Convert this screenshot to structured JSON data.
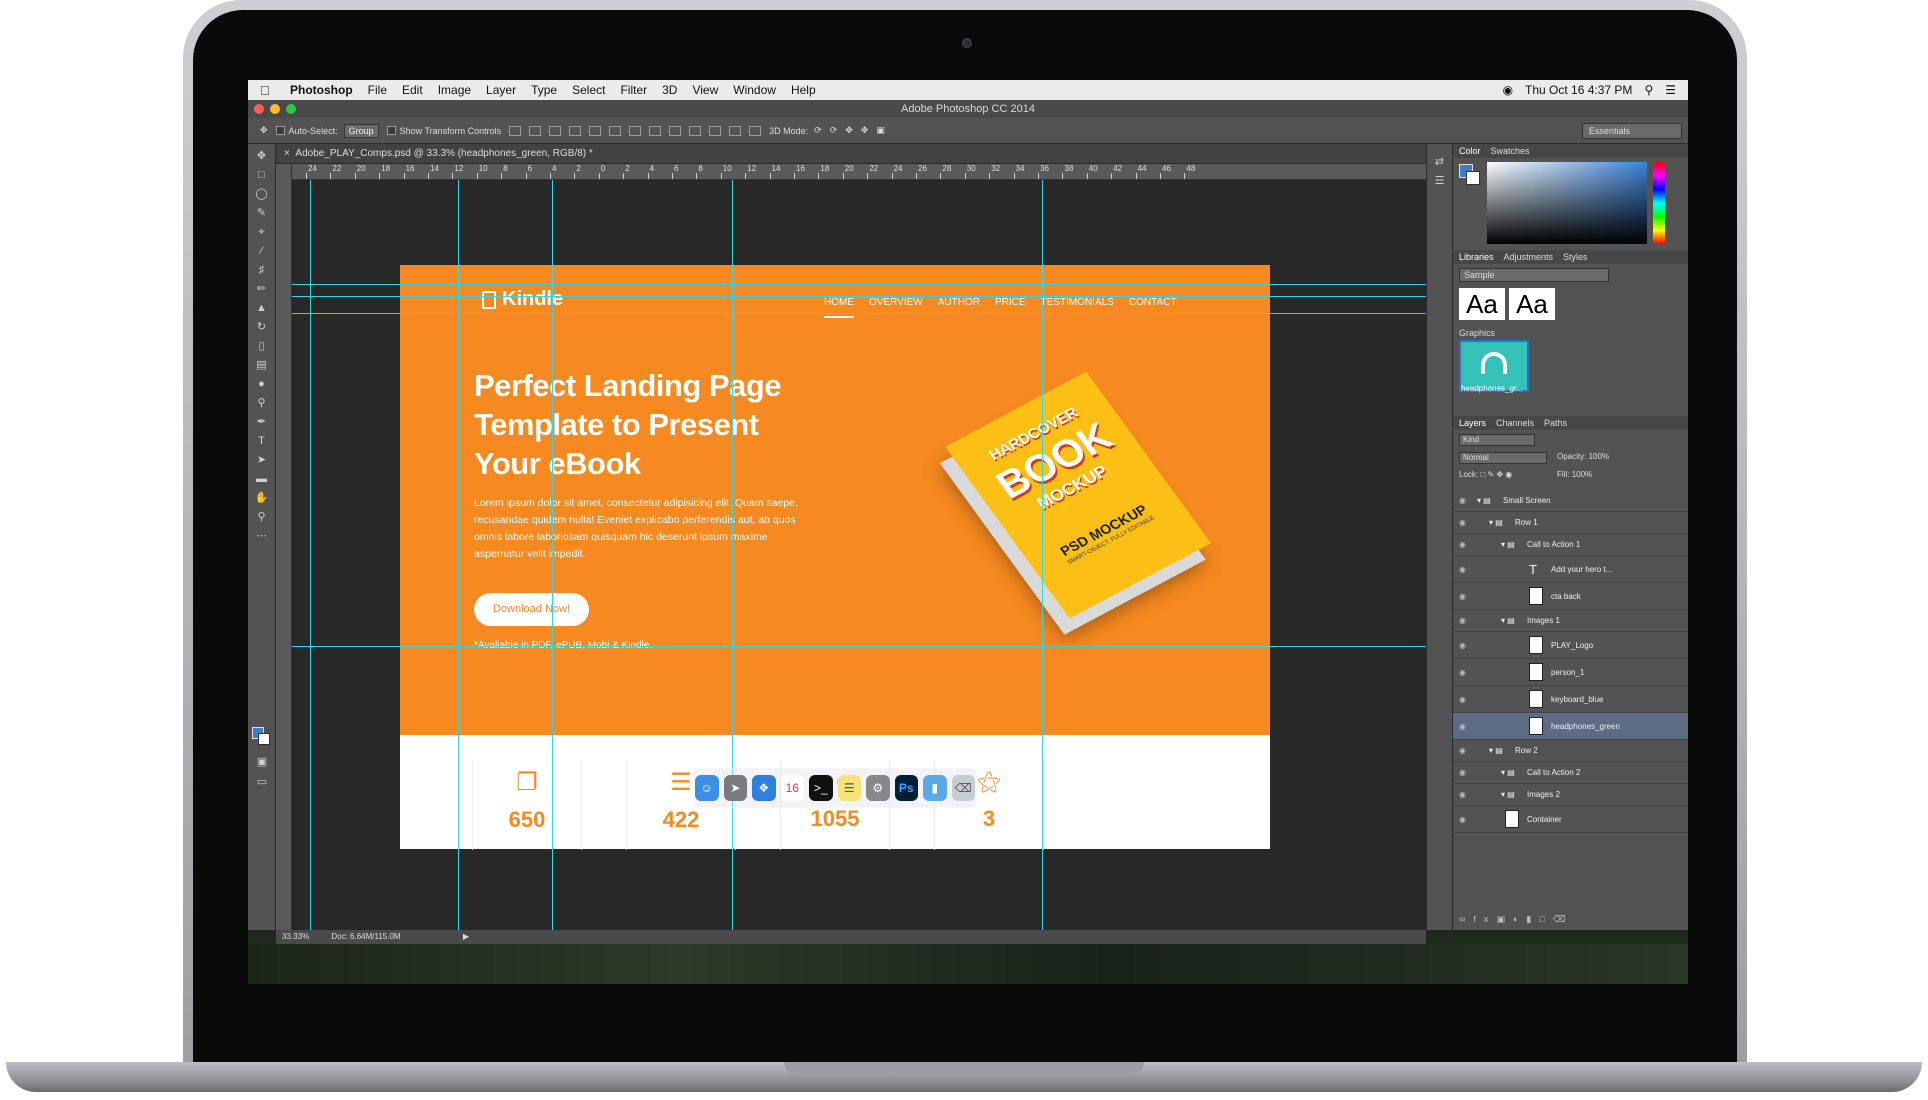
{
  "menubar": {
    "app_name": "Photoshop",
    "items": [
      "File",
      "Edit",
      "Image",
      "Layer",
      "Type",
      "Select",
      "Filter",
      "3D",
      "View",
      "Window",
      "Help"
    ],
    "clock": "Thu Oct 16  4:37 PM"
  },
  "window": {
    "title": "Adobe Photoshop CC 2014"
  },
  "options": {
    "auto_select": "Auto-Select:",
    "group_value": "Group",
    "show_transform": "Show Transform Controls",
    "mode_3d": "3D Mode:",
    "workspace": "Essentials"
  },
  "document": {
    "tab_title": "Adobe_PLAY_Comps.psd @ 33.3% (headphones_green, RGB/8) *",
    "zoom": "33.33%",
    "doc_size": "Doc: 6.64M/115.0M"
  },
  "ruler_h": [
    "24",
    "22",
    "20",
    "18",
    "16",
    "14",
    "12",
    "10",
    "8",
    "6",
    "4",
    "2",
    "0",
    "2",
    "4",
    "6",
    "8",
    "10",
    "12",
    "14",
    "16",
    "18",
    "20",
    "22",
    "24",
    "26",
    "28",
    "30",
    "32",
    "34",
    "36",
    "38",
    "40",
    "42",
    "44",
    "46",
    "48"
  ],
  "landing": {
    "logo": "Kindle",
    "nav": [
      "HOME",
      "OVERVIEW",
      "AUTHOR",
      "PRICE",
      "TESTIMONIALS",
      "CONTACT"
    ],
    "hero_title": "Perfect Landing Page Template to Present Your eBook",
    "hero_text": "Lorem ipsum dolor sit amet, consectetur adipisicing elit. Quam saepe, recusandae quidem nulla! Eveniet explicabo perferendis aut, ab quos omnis labore laboriosam quisquam hic deserunt ipsum maxime aspernatur velit impedit.",
    "cta_label": "Download Now!",
    "availability": "*Avaliable in PDF, ePUB, Mobi & Kindle.",
    "book": {
      "line1": "HARDCOVER",
      "line2": "BOOK",
      "line3": "MOCKUP",
      "line4": "PSD MOCKUP",
      "line5": "SMART-OBJECT, FULLY EDITABLE"
    },
    "stats": [
      "650",
      "422",
      "1055",
      "3"
    ],
    "stat_icons": [
      "copy-icon",
      "document-icon",
      "users-icon",
      "trophy-icon"
    ],
    "brand_color": "#f6891f"
  },
  "panels": {
    "color_tabs": [
      "Color",
      "Swatches"
    ],
    "library_tabs": [
      "Libraries",
      "Adjustments",
      "Styles"
    ],
    "library_name": "Sample",
    "aa_samples": [
      "Aa",
      "Aa"
    ],
    "graphics_label": "Graphics",
    "graphic_name": "headphones_gr...",
    "layers_tabs": [
      "Layers",
      "Channels",
      "Paths"
    ],
    "kind": "Kind",
    "blend": "Normal",
    "opacity_label": "Opacity:",
    "opacity": "100%",
    "lock_label": "Lock:",
    "fill_label": "Fill:",
    "fill": "100%",
    "layers": [
      {
        "name": "Small Screen",
        "indent": 0,
        "type": "group"
      },
      {
        "name": "Row 1",
        "indent": 1,
        "type": "group"
      },
      {
        "name": "Call to Action 1",
        "indent": 2,
        "type": "group"
      },
      {
        "name": "Add your hero t...",
        "indent": 3,
        "type": "text"
      },
      {
        "name": "cta back",
        "indent": 3,
        "type": "layer"
      },
      {
        "name": "Images 1",
        "indent": 2,
        "type": "group"
      },
      {
        "name": "PLAY_Logo",
        "indent": 3,
        "type": "layer"
      },
      {
        "name": "person_1",
        "indent": 3,
        "type": "layer"
      },
      {
        "name": "keyboard_blue",
        "indent": 3,
        "type": "layer"
      },
      {
        "name": "headphones_green",
        "indent": 3,
        "type": "layer"
      },
      {
        "name": "Row 2",
        "indent": 1,
        "type": "group"
      },
      {
        "name": "Call to Action 2",
        "indent": 2,
        "type": "group"
      },
      {
        "name": "Images 2",
        "indent": 2,
        "type": "group"
      },
      {
        "name": "Container",
        "indent": 1,
        "type": "layer"
      }
    ]
  },
  "dock": [
    "finder-icon",
    "launchpad-icon",
    "safari-icon",
    "calendar-icon",
    "terminal-icon",
    "notes-icon",
    "preferences-icon",
    "photoshop-icon",
    "folder-icon",
    "trash-icon"
  ],
  "dock_labels": {
    "calendar": "16",
    "photoshop": "Ps"
  }
}
